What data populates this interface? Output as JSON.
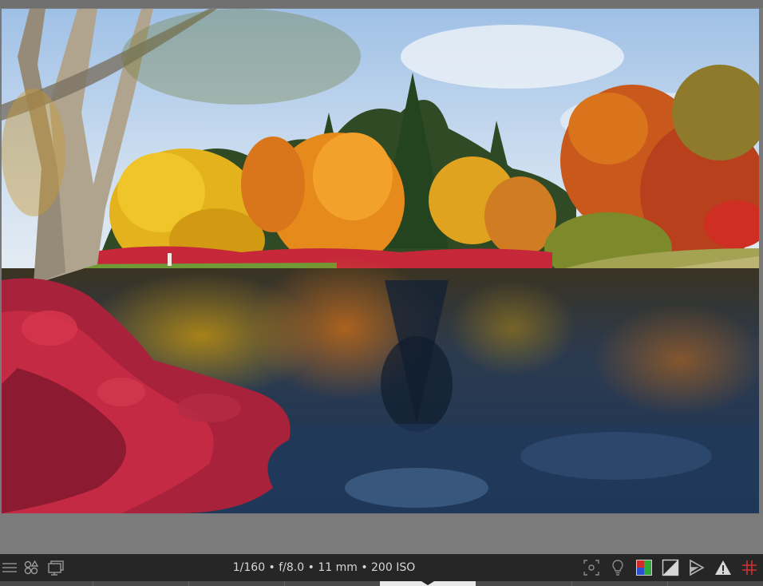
{
  "viewer": {
    "photo_alt": "autumn-pond-photo"
  },
  "toolbar": {
    "exif_text": "1/160 • f/8.0 • 11 mm • 200 ISO",
    "left_icons": [
      "menu-icon",
      "shapes-icon",
      "monitor-icon"
    ],
    "right_icons": [
      "focus-frame-icon",
      "bulb-icon",
      "color-grid-icon",
      "contrast-icon",
      "softproof-icon",
      "warning-icon",
      "grid-icon"
    ]
  },
  "colors": {
    "toolbar_bg": "#262626",
    "band_bg": "#7b7b7b",
    "grid_accent": "#d03030",
    "warning_fg": "#dddddd"
  }
}
